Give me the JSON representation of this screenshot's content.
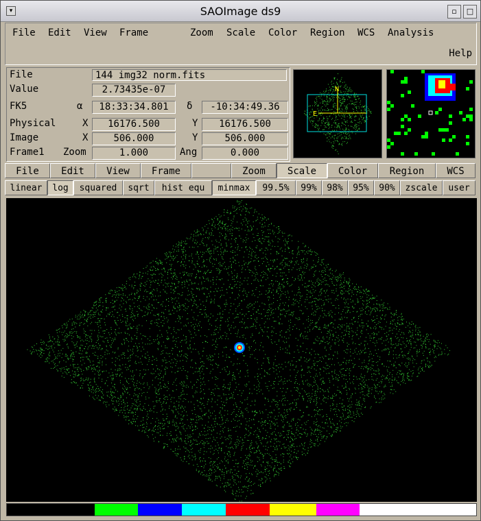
{
  "window": {
    "title": "SAOImage ds9"
  },
  "menu": {
    "items": [
      "File",
      "Edit",
      "View",
      "Frame",
      "Zoom",
      "Scale",
      "Color",
      "Region",
      "WCS",
      "Analysis"
    ],
    "help": "Help"
  },
  "info": {
    "file_label": "File",
    "file_value": "144_img32_norm.fits",
    "value_label": "Value",
    "value_value": "2.73435e-07",
    "fk5_label": "FK5",
    "alpha_sym": "α",
    "alpha_value": "18:33:34.801",
    "delta_sym": "δ",
    "delta_value": "-10:34:49.36",
    "physical_label": "Physical",
    "physical_x_label": "X",
    "physical_x": "16176.500",
    "physical_y_label": "Y",
    "physical_y": "16176.500",
    "image_label": "Image",
    "image_x_label": "X",
    "image_x": "506.000",
    "image_y_label": "Y",
    "image_y": "506.000",
    "frame_label": "Frame1",
    "zoom_label": "Zoom",
    "zoom_value": "1.000",
    "ang_label": "Ang",
    "ang_value": "0.000"
  },
  "panner": {
    "north_label": "N",
    "east_label": "E"
  },
  "buttonbar": {
    "items": [
      "File",
      "Edit",
      "View",
      "Frame",
      "",
      "Zoom",
      "Scale",
      "Color",
      "Region",
      "WCS"
    ],
    "active": "Scale"
  },
  "scalebar": {
    "items": [
      "linear",
      "log",
      "squared",
      "sqrt",
      "hist equ",
      "minmax",
      "99.5%",
      "99%",
      "98%",
      "95%",
      "90%",
      "zscale",
      "user"
    ],
    "active": [
      "log",
      "minmax"
    ]
  },
  "colors": {
    "colorbar": [
      "#000000",
      "#00ff00",
      "#0000ff",
      "#00ffff",
      "#ff0000",
      "#ffff00",
      "#ff00ff",
      "#ffffff"
    ],
    "points": "#33cc33"
  }
}
